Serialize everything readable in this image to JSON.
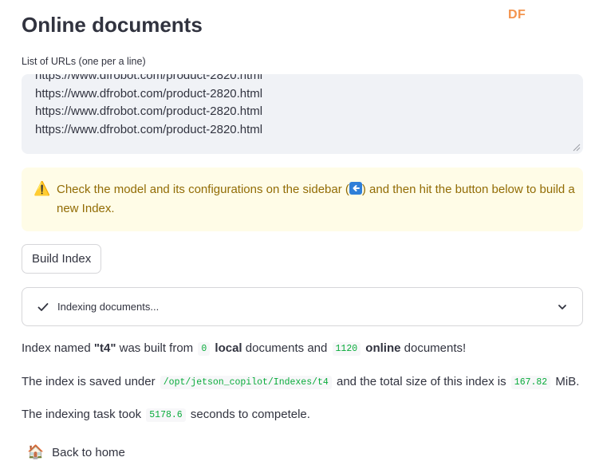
{
  "logo": {
    "text": "DF"
  },
  "page": {
    "title": "Online documents"
  },
  "urls": {
    "label": "List of URLs (one per a line)",
    "lines": [
      "https://www.dfrobot.com/product-2820.html",
      "https://www.dfrobot.com/product-2820.html",
      "https://www.dfrobot.com/product-2820.html",
      "https://www.dfrobot.com/product-2820.html"
    ]
  },
  "warning": {
    "icon": "warning-icon",
    "text_before": "Check the model and its configurations on the sidebar (",
    "text_after": ") and then hit the button below to build a new Index."
  },
  "build_button": {
    "label": "Build Index"
  },
  "status": {
    "label": "Indexing documents...",
    "state": "done"
  },
  "result": {
    "l1_prefix": "Index named ",
    "index_name": "\"t4\"",
    "l1_mid1": " was built from ",
    "local_count": "0",
    "local_word": "local",
    "l1_mid2": " documents and ",
    "online_count": "1120",
    "online_word": "online",
    "l1_suffix": " documents!",
    "l2_prefix": "The index is saved under ",
    "path": "/opt/jetson_copilot/Indexes/t4",
    "l2_mid": " and the total size of this index is ",
    "size": "167.82",
    "size_unit": " MiB.",
    "l3_prefix": "The indexing task took ",
    "seconds": "5178.6",
    "l3_suffix": " seconds to competele."
  },
  "home": {
    "icon": "house-icon",
    "label": "Back to home"
  },
  "colors": {
    "warning_bg": "#fffce7",
    "warning_text": "#926c05",
    "code_text": "#09ab3b",
    "logo": "#f4944e"
  }
}
